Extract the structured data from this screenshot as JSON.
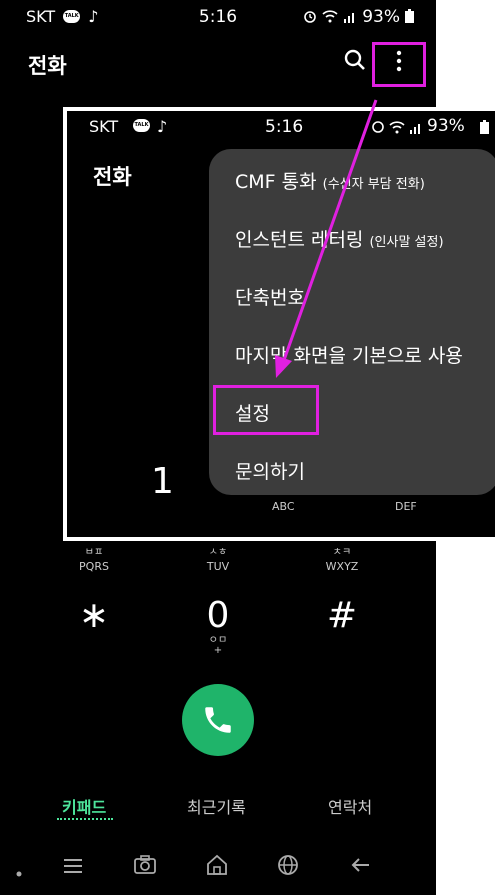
{
  "status": {
    "carrier": "SKT",
    "talk": "TALK",
    "music": "♪",
    "time": "5:16",
    "battery": "93%"
  },
  "header": {
    "title": "전화"
  },
  "keypad": {
    "partial_letters": [
      "ㅂㅍ",
      "ㅅㅎ",
      "ㅊㅋ"
    ],
    "row3": [
      {
        "letters": "PQRS"
      },
      {
        "letters": "TUV"
      },
      {
        "letters": "WXYZ"
      }
    ],
    "row4": [
      {
        "digit": "∗"
      },
      {
        "digit": "0",
        "sub": "ㅇㅁ",
        "plus": "+"
      },
      {
        "digit": "#"
      }
    ]
  },
  "tabs": [
    {
      "label": "키패드"
    },
    {
      "label": "최근기록"
    },
    {
      "label": "연락처"
    }
  ],
  "inset": {
    "status": {
      "carrier": "SKT",
      "talk": "TALK",
      "music": "♪",
      "time": "5:16",
      "battery": "93%"
    },
    "title": "전화",
    "digit": "1",
    "abc": "ABC",
    "def": "DEF",
    "menu": [
      {
        "label": "CMF 통화",
        "sub": "(수신자 부담 전화)"
      },
      {
        "label": "인스턴트 레터링",
        "sub": "(인사말 설정)"
      },
      {
        "label": "단축번호",
        "sub": ""
      },
      {
        "label": "마지막 화면을 기본으로 사용",
        "sub": ""
      },
      {
        "label": "설정",
        "sub": ""
      },
      {
        "label": "문의하기",
        "sub": ""
      }
    ]
  },
  "colors": {
    "highlight": "#e020e0",
    "call": "#1fb46a",
    "active_tab": "#4ee59c"
  }
}
